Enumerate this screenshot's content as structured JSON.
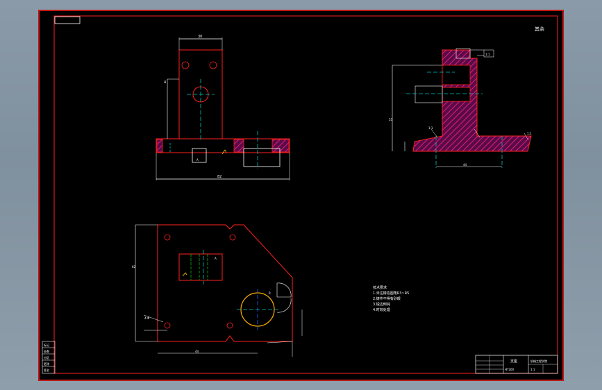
{
  "drawing": {
    "roughness_mark": "其余",
    "dims_front": {
      "top_width": "30",
      "left_height": "4",
      "bottom_width": "82",
      "slot_label": "A"
    },
    "dims_side": {
      "top_right": "1:1",
      "flange_left": "1:1",
      "flange_right": "1:1",
      "bottom_width": "44",
      "height_label": "55"
    },
    "dims_plan": {
      "hole_label": "A",
      "left_height": "62",
      "hole_note": "4-Φ",
      "bottom_label": "44",
      "right_label": "R"
    },
    "notes": [
      "技术要求",
      "1.未注铸造圆角R3~R5",
      "2.铸件不得有砂眼",
      "3.锐边倒钝",
      "4.时效处理"
    ],
    "title_block": {
      "name": "支座",
      "material": "HT200",
      "scale": "1:1",
      "school": "机械工程学院"
    },
    "revision_table": [
      "标记",
      "处数",
      "分区",
      "更改",
      "签名"
    ]
  }
}
